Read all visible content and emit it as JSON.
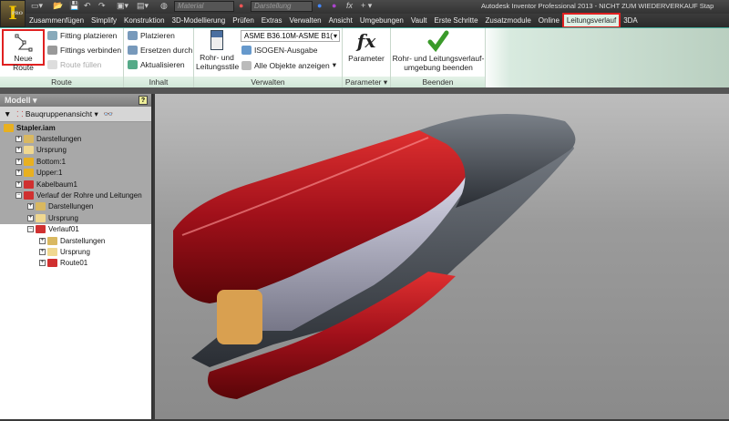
{
  "app": {
    "logo": "I",
    "edition": "PRO",
    "title": "Autodesk Inventor Professional 2013 - NICHT ZUM WIEDERVERKAUF   Stap"
  },
  "quick_access": {
    "material": "Material",
    "appearance": "Darstellung"
  },
  "tabs": [
    "Zusammenfügen",
    "Simplify",
    "Konstruktion",
    "3D-Modellierung",
    "Prüfen",
    "Extras",
    "Verwalten",
    "Ansicht",
    "Umgebungen",
    "Vault",
    "Erste Schritte",
    "Zusatzmodule",
    "Online",
    "Leitungsverlauf",
    "3DA"
  ],
  "active_tab": "Leitungsverlauf",
  "ribbon": {
    "route": {
      "label": "Route",
      "new_route": "Neue Route",
      "place_fitting": "Fitting platzieren",
      "connect_fittings": "Fittings verbinden",
      "fill_route": "Route füllen"
    },
    "inhalt": {
      "label": "Inhalt",
      "place": "Platzieren",
      "replace": "Ersetzen durch",
      "update": "Aktualisieren"
    },
    "verwalten": {
      "label": "Verwalten",
      "styles_line1": "Rohr- und",
      "styles_line2": "Leitungsstile",
      "style_select": "ASME B36.10M-ASME B1(",
      "isogen": "ISOGEN-Ausgabe",
      "show_all": "Alle Objekte anzeigen"
    },
    "parameter": {
      "label": "Parameter",
      "button": "Parameter"
    },
    "beenden": {
      "label": "Beenden",
      "line1": "Rohr- und Leitungsverlauf-",
      "line2": "umgebung beenden"
    }
  },
  "browser": {
    "title": "Modell",
    "view": "Bauqruppenansicht",
    "tree": [
      {
        "label": "Stapler.iam",
        "level": 0,
        "bold": true,
        "color": "#e8b020"
      },
      {
        "label": "Darstellungen",
        "level": 1,
        "color": "#d9b860"
      },
      {
        "label": "Ursprung",
        "level": 1,
        "color": "#f0d890"
      },
      {
        "label": "Bottom:1",
        "level": 1,
        "color": "#e8b020"
      },
      {
        "label": "Upper:1",
        "level": 1,
        "color": "#e8b020"
      },
      {
        "label": "Kabelbaum1",
        "level": 1,
        "color": "#d03030"
      },
      {
        "label": "Verlauf der Rohre und Leitungen",
        "level": 1,
        "color": "#d03030",
        "open": true
      },
      {
        "label": "Darstellungen",
        "level": 2,
        "color": "#d9b860"
      },
      {
        "label": "Ursprung",
        "level": 2,
        "color": "#f0d890"
      },
      {
        "label": "Verlauf01",
        "level": 2,
        "color": "#d03030",
        "open": true,
        "white": true
      },
      {
        "label": "Darstellungen",
        "level": 3,
        "color": "#d9b860",
        "white": true
      },
      {
        "label": "Ursprung",
        "level": 3,
        "color": "#f0d890",
        "white": true
      },
      {
        "label": "Route01",
        "level": 3,
        "color": "#d03030",
        "white": true
      }
    ]
  }
}
